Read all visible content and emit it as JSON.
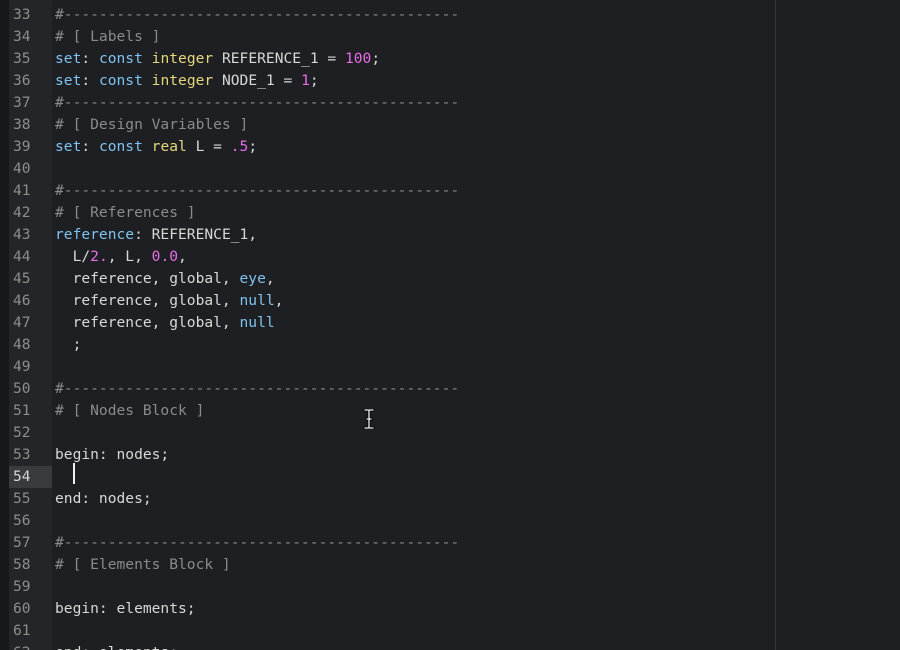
{
  "editor": {
    "current_line": "54",
    "lines": [
      {
        "number": "33",
        "tokens": [
          {
            "t": "#---------------------------------------------",
            "c": "comment"
          }
        ]
      },
      {
        "number": "34",
        "tokens": [
          {
            "t": "# [ Labels ]",
            "c": "comment"
          }
        ]
      },
      {
        "number": "35",
        "tokens": [
          {
            "t": "set",
            "c": "kw"
          },
          {
            "t": ": ",
            "c": "plain"
          },
          {
            "t": "const",
            "c": "kw"
          },
          {
            "t": " ",
            "c": "plain"
          },
          {
            "t": "integer",
            "c": "type"
          },
          {
            "t": " REFERENCE_1 = ",
            "c": "plain"
          },
          {
            "t": "100",
            "c": "num"
          },
          {
            "t": ";",
            "c": "plain"
          }
        ]
      },
      {
        "number": "36",
        "tokens": [
          {
            "t": "set",
            "c": "kw"
          },
          {
            "t": ": ",
            "c": "plain"
          },
          {
            "t": "const",
            "c": "kw"
          },
          {
            "t": " ",
            "c": "plain"
          },
          {
            "t": "integer",
            "c": "type"
          },
          {
            "t": " NODE_1 = ",
            "c": "plain"
          },
          {
            "t": "1",
            "c": "num"
          },
          {
            "t": ";",
            "c": "plain"
          }
        ]
      },
      {
        "number": "37",
        "tokens": [
          {
            "t": "#---------------------------------------------",
            "c": "comment"
          }
        ]
      },
      {
        "number": "38",
        "tokens": [
          {
            "t": "# [ Design Variables ]",
            "c": "comment"
          }
        ]
      },
      {
        "number": "39",
        "tokens": [
          {
            "t": "set",
            "c": "kw"
          },
          {
            "t": ": ",
            "c": "plain"
          },
          {
            "t": "const",
            "c": "kw"
          },
          {
            "t": " ",
            "c": "plain"
          },
          {
            "t": "real",
            "c": "type"
          },
          {
            "t": " L = ",
            "c": "plain"
          },
          {
            "t": ".5",
            "c": "num"
          },
          {
            "t": ";",
            "c": "plain"
          }
        ]
      },
      {
        "number": "40",
        "tokens": []
      },
      {
        "number": "41",
        "tokens": [
          {
            "t": "#---------------------------------------------",
            "c": "comment"
          }
        ]
      },
      {
        "number": "42",
        "tokens": [
          {
            "t": "# [ References ]",
            "c": "comment"
          }
        ]
      },
      {
        "number": "43",
        "tokens": [
          {
            "t": "reference",
            "c": "kw"
          },
          {
            "t": ": REFERENCE_1,",
            "c": "plain"
          }
        ]
      },
      {
        "number": "44",
        "tokens": [
          {
            "t": "  L/",
            "c": "plain"
          },
          {
            "t": "2.",
            "c": "num"
          },
          {
            "t": ", L, ",
            "c": "plain"
          },
          {
            "t": "0.0",
            "c": "num"
          },
          {
            "t": ",",
            "c": "plain"
          }
        ]
      },
      {
        "number": "45",
        "tokens": [
          {
            "t": "  reference, global, ",
            "c": "plain"
          },
          {
            "t": "eye",
            "c": "builtin"
          },
          {
            "t": ",",
            "c": "plain"
          }
        ]
      },
      {
        "number": "46",
        "tokens": [
          {
            "t": "  reference, global, ",
            "c": "plain"
          },
          {
            "t": "null",
            "c": "builtin"
          },
          {
            "t": ",",
            "c": "plain"
          }
        ]
      },
      {
        "number": "47",
        "tokens": [
          {
            "t": "  reference, global, ",
            "c": "plain"
          },
          {
            "t": "null",
            "c": "builtin"
          }
        ]
      },
      {
        "number": "48",
        "tokens": [
          {
            "t": "  ;",
            "c": "plain"
          }
        ]
      },
      {
        "number": "49",
        "tokens": []
      },
      {
        "number": "50",
        "tokens": [
          {
            "t": "#---------------------------------------------",
            "c": "comment"
          }
        ]
      },
      {
        "number": "51",
        "tokens": [
          {
            "t": "# [ Nodes Block ]",
            "c": "comment"
          }
        ]
      },
      {
        "number": "52",
        "tokens": []
      },
      {
        "number": "53",
        "tokens": [
          {
            "t": "begin: nodes;",
            "c": "plain"
          }
        ]
      },
      {
        "number": "54",
        "tokens": []
      },
      {
        "number": "55",
        "tokens": [
          {
            "t": "end: nodes;",
            "c": "plain"
          }
        ]
      },
      {
        "number": "56",
        "tokens": []
      },
      {
        "number": "57",
        "tokens": [
          {
            "t": "#---------------------------------------------",
            "c": "comment"
          }
        ]
      },
      {
        "number": "58",
        "tokens": [
          {
            "t": "# [ Elements Block ]",
            "c": "comment"
          }
        ]
      },
      {
        "number": "59",
        "tokens": []
      },
      {
        "number": "60",
        "tokens": [
          {
            "t": "begin: elements;",
            "c": "plain"
          }
        ]
      },
      {
        "number": "61",
        "tokens": []
      },
      {
        "number": "62",
        "tokens": [
          {
            "t": "end: elements;",
            "c": "plain"
          }
        ]
      }
    ]
  },
  "colors": {
    "background": "#1e1f22",
    "gutter": "#242528",
    "keyword": "#7ec3f0",
    "type": "#e6d77a",
    "number": "#e96de4",
    "comment": "#8b8b8b",
    "text": "#d8d8d8"
  },
  "icons": {
    "mouse_cursor": "text-ibeam-cursor-icon"
  }
}
